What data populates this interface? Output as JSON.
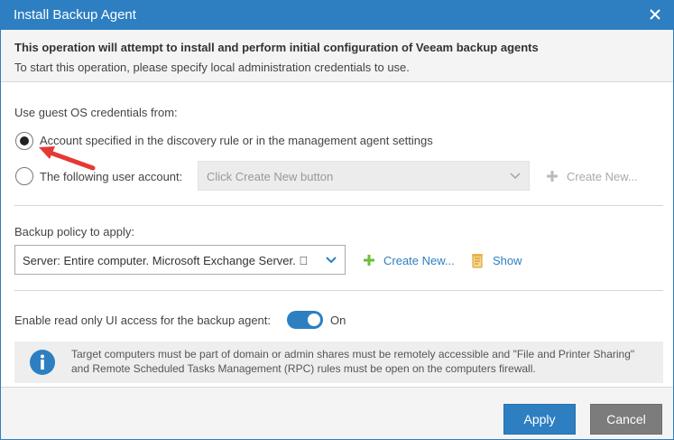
{
  "window": {
    "title": "Install Backup Agent"
  },
  "header": {
    "title": "This operation will attempt to install and perform initial configuration of Veeam backup agents",
    "subtitle": "To start this operation, please specify local administration credentials to use."
  },
  "credentials": {
    "label": "Use guest OS credentials from:",
    "option_account_specified": "Account specified in the discovery rule or in the management agent settings",
    "option_following_user": "The following user account:",
    "selected": "Account specified in the discovery rule or in the management agent settings",
    "user_select_placeholder": "Click Create New button",
    "create_new_label": "Create New..."
  },
  "policy": {
    "label": "Backup policy to apply:",
    "selected_value": "Server: Entire computer. Microsoft Exchange Server. \u0000",
    "create_new_label": "Create New...",
    "show_label": "Show"
  },
  "readonly_access": {
    "label": "Enable read only UI access for the backup agent:",
    "toggle_state": "On",
    "enabled": true
  },
  "info": {
    "text": "Target computers must be part of domain or admin shares must be remotely accessible and \"File and Printer Sharing\" and Remote Scheduled Tasks Management (RPC) rules must be open on the computers firewall."
  },
  "footer": {
    "apply_label": "Apply",
    "cancel_label": "Cancel"
  },
  "colors": {
    "accent": "#2d7fc1",
    "green_plus": "#6bbf3a",
    "annotation_arrow": "#e53935",
    "cancel_gray": "#7c7c7c"
  },
  "icons": {
    "close": "close-icon",
    "chevron": "chevron-down-icon",
    "plus": "plus-icon",
    "scroll": "scroll-icon",
    "info": "info-icon",
    "arrow": "annotation-arrow-icon"
  }
}
